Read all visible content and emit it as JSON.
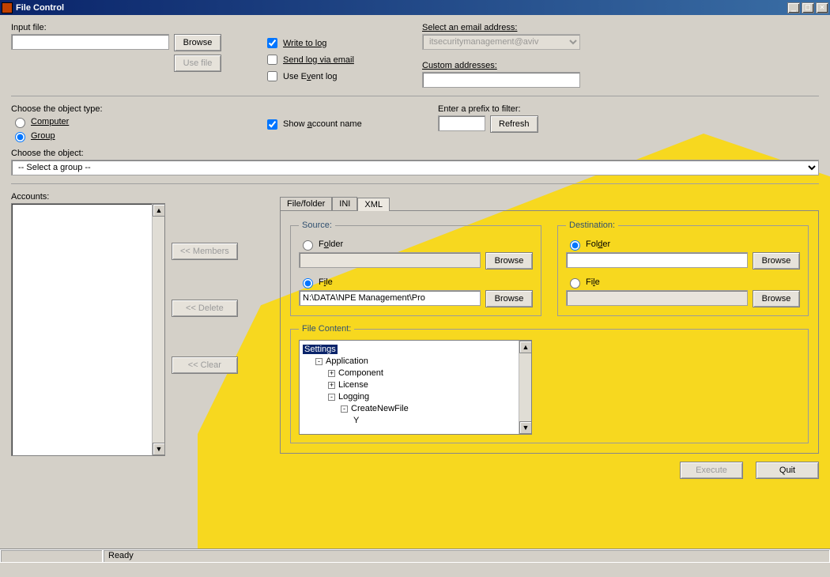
{
  "window": {
    "title": "File Control"
  },
  "top": {
    "input_file_label": "Input file:",
    "input_file_value": "",
    "browse": "Browse",
    "use_file": "Use file",
    "write_log": "Write to log",
    "send_log_email": "Send log via email",
    "use_event_log": "Use Event log",
    "select_email_label": "Select an email address:",
    "email_selected": "itsecuritymanagement@aviv",
    "custom_addresses_label": "Custom addresses:",
    "custom_addresses_value": ""
  },
  "objtype": {
    "label": "Choose the object type:",
    "computer": "Computer",
    "group": "Group",
    "show_account": "Show account name",
    "prefix_label": "Enter a prefix to filter:",
    "prefix_value": "",
    "refresh": "Refresh",
    "choose_object_label": "Choose the object:",
    "object_selected": "-- Select a group --"
  },
  "accounts": {
    "label": "Accounts:",
    "members_btn": "<< Members",
    "delete_btn": "<< Delete",
    "clear_btn": "<< Clear"
  },
  "tabs": {
    "filefolder": "File/folder",
    "ini": "INI",
    "xml": "XML"
  },
  "source": {
    "legend": "Source:",
    "folder": "Folder",
    "folder_value": "",
    "file": "File",
    "file_value": "N:\\DATA\\NPE Management\\Pro",
    "browse": "Browse"
  },
  "dest": {
    "legend": "Destination:",
    "folder": "Folder",
    "folder_value": "",
    "file": "File",
    "file_value": "",
    "browse": "Browse"
  },
  "filecontent": {
    "legend": "File Content:",
    "tree": {
      "root": "Settings",
      "n1": "Application",
      "n1a": "Component",
      "n1b": "License",
      "n1c": "Logging",
      "n1c1": "CreateNewFile",
      "n1c1a": "Y"
    }
  },
  "footer": {
    "execute": "Execute",
    "quit": "Quit"
  },
  "status": {
    "ready": "Ready"
  }
}
